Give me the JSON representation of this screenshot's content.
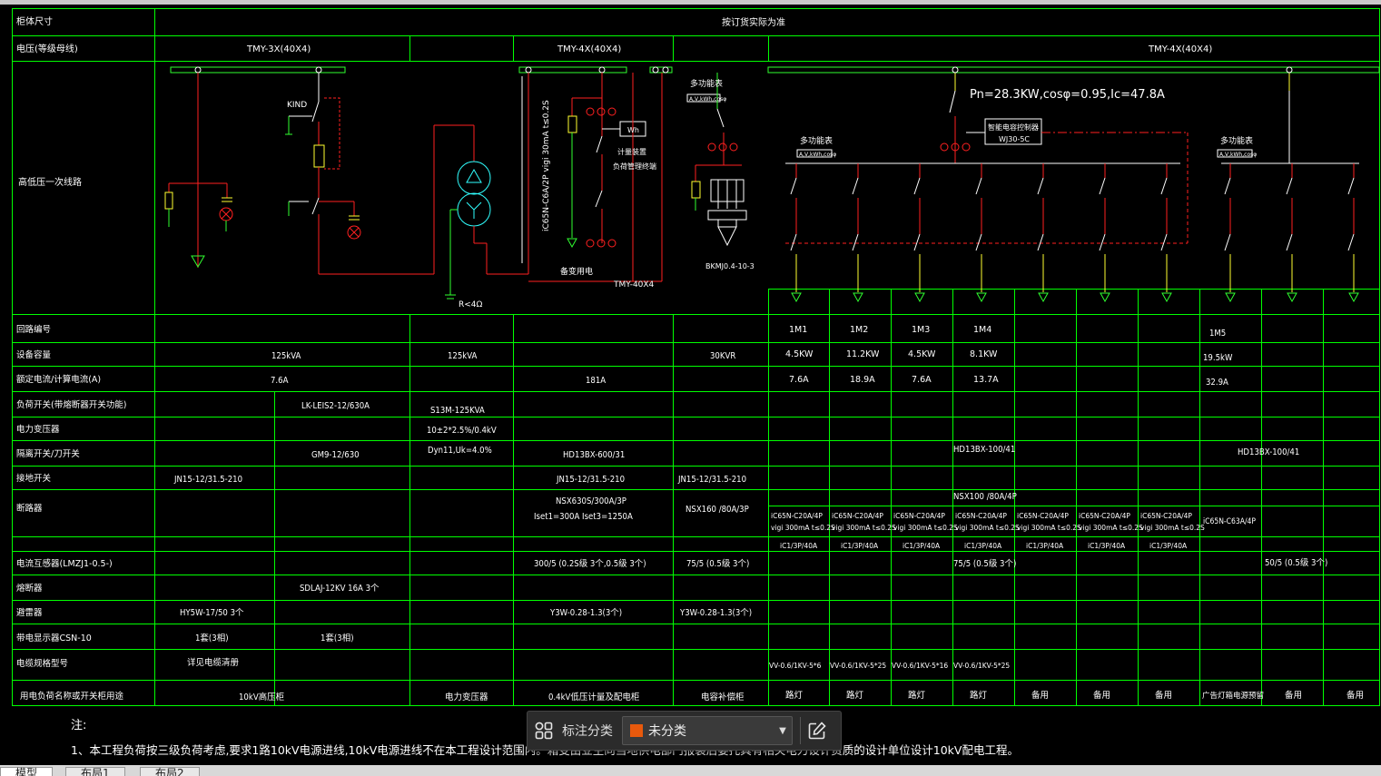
{
  "drawing": {
    "colors": {
      "grid": "#00ff00",
      "text": "#ffffff",
      "header_text": "#ffffff",
      "line_red": "#ff2020",
      "line_yellow": "#ffff30",
      "line_green": "#30ff30",
      "line_cyan": "#30ffff",
      "bg": "#000000"
    },
    "header": {
      "cabinet_size_label": "柜体尺寸",
      "cabinet_size_value": "按订货实际为准",
      "busbar_label": "电压(等级母线)",
      "bus1": "TMY-3X(40X4)",
      "bus2": "TMY-4X(40X4)",
      "bus3": "TMY-4X(40X4)",
      "diagram_label": "高低压一次线路"
    },
    "diagram_text": {
      "kind": "KIND",
      "ground": "R<4Ω",
      "breaker_label": "iC65N-C6A/2P vigi 30mA t≤0.2S",
      "meter_label": "计量装置 负荷管理终端",
      "wh": "Wh",
      "stand_by": "备变用电",
      "bus_small": "TMY-40X4",
      "multi_meter_1": "多功能表",
      "multi_meter_1_sub": "A,V,kWh,cosφ",
      "capacitor": "BKMJ0.4-10-3",
      "load_calc": "Pn=28.3KW,cosφ=0.95,Ic=47.8A",
      "controller_1": "智能电容控制器",
      "controller_2": "WJ30-5C",
      "multi_meter_2": "多功能表",
      "multi_meter_2_sub": "A,V,kWh,cosφ",
      "multi_meter_3": "多功能表",
      "multi_meter_3_sub": "A,V,kWh,cosφ"
    },
    "rows": {
      "circuit_no": "回路编号",
      "capacity": "设备容量",
      "current": "额定电流/计算电流(A)",
      "load_switch": "负荷开关(带熔断器开关功能)",
      "transformer": "电力变压器",
      "isolator": "隔离开关/刀开关",
      "earth_switch": "接地开关",
      "breaker": "断路器",
      "ct": "电流互感器(LMZJ1-0.5-)",
      "fuse": "熔断器",
      "arrester": "避雷器",
      "indicator": "带电显示器CSN-10",
      "cable": "电缆规格型号",
      "purpose": "用电负荷名称或开关柜用途"
    },
    "values": {
      "cap_hv": "125kVA",
      "cap_tr": "125kVA",
      "cap_cap": "30KVR",
      "cur_hv": "7.6A",
      "cur_lv": "181A",
      "ls_val": "LK-LEIS2-12/630A",
      "tr1": "S13M-125KVA",
      "tr2": "10±2*2.5%/0.4kV",
      "tr3": "Dyn11,Uk=4.0%",
      "iso_hv": "GM9-12/630",
      "iso_lv": "HD13BX-600/31",
      "iso_out": "HD13BX-100/41",
      "iso_out2": "HD13BX-100/41",
      "es1": "JN15-12/31.5-210",
      "es2": "JN15-12/31.5-210",
      "es3": "JN15-12/31.5-210",
      "br_main1": "NSX630S/300A/3P",
      "br_main2": "Iset1=300A    Iset3=1250A",
      "br_cap": "NSX160 /80A/3P",
      "br_out_hdr": "NSX100 /80A/4P",
      "br_last": "iC65N-C63A/4P",
      "ct_main": "300/5 (0.2S级 3个,0.5级 3个)",
      "ct_cap": "75/5 (0.5级 3个)",
      "ct_out": "75/5 (0.5级 3个)",
      "ct_last": "50/5 (0.5级 3个)",
      "fuse_val": "SDLAJ-12KV  16A  3个",
      "arr_hv": "HY5W-17/50   3个",
      "arr_lv": "Y3W-0.28-1.3(3个)",
      "arr_cap": "Y3W-0.28-1.3(3个)",
      "ind1": "1套(3相)",
      "ind2": "1套(3相)",
      "cable_hv": "详见电缆清册",
      "purp_hv": "10kV高压柜",
      "purp_tr": "电力变压器",
      "purp_lv": "0.4kV低压计量及配电柜",
      "purp_cap": "电容补偿柜",
      "purp_last": "广告灯箱电源预留"
    },
    "feeders": [
      {
        "no": "1M1",
        "kw": "4.5KW",
        "a": "7.6A",
        "br1": "iC65N-C20A/4P",
        "br2": "vigi 300mA  t≤0.2S",
        "aux": "iC1/3P/40A",
        "cable": "VV-0.6/1KV-5*6",
        "purpose": "路灯"
      },
      {
        "no": "1M2",
        "kw": "11.2KW",
        "a": "18.9A",
        "br1": "iC65N-C20A/4P",
        "br2": "vigi 300mA  t≤0.2S",
        "aux": "iC1/3P/40A",
        "cable": "VV-0.6/1KV-5*25",
        "purpose": "路灯"
      },
      {
        "no": "1M3",
        "kw": "4.5KW",
        "a": "7.6A",
        "br1": "iC65N-C20A/4P",
        "br2": "vigi 300mA  t≤0.2S",
        "aux": "iC1/3P/40A",
        "cable": "VV-0.6/1KV-5*16",
        "purpose": "路灯"
      },
      {
        "no": "1M4",
        "kw": "8.1KW",
        "a": "13.7A",
        "br1": "iC65N-C20A/4P",
        "br2": "vigi 300mA  t≤0.2S",
        "aux": "iC1/3P/40A",
        "cable": "VV-0.6/1KV-5*25",
        "purpose": "路灯"
      },
      {
        "no": "",
        "kw": "",
        "a": "",
        "br1": "iC65N-C20A/4P",
        "br2": "vigi 300mA  t≤0.2S",
        "aux": "iC1/3P/40A",
        "cable": "",
        "purpose": "备用"
      },
      {
        "no": "",
        "kw": "",
        "a": "",
        "br1": "iC65N-C20A/4P",
        "br2": "vigi 300mA  t≤0.2S",
        "aux": "iC1/3P/40A",
        "cable": "",
        "purpose": "备用"
      },
      {
        "no": "",
        "kw": "",
        "a": "",
        "br1": "iC65N-C20A/4P",
        "br2": "vigi 300mA  t≤0.2S",
        "aux": "iC1/3P/40A",
        "cable": "",
        "purpose": "备用"
      }
    ],
    "last_feeder": {
      "no": "1M5",
      "kw": "19.5kW",
      "a": "32.9A"
    },
    "tail_purposes": [
      "备用",
      "备用"
    ],
    "notes_title": "注:",
    "notes_line1": "1、本工程负荷按三级负荷考虑,要求1路10kV电源进线,10kV电源进线不在本工程设计范围内。箱变由业主向当地供电部门报装后委托具有相关电力设计资质的设计单位设计10kV配电工程。"
  },
  "toolbar": {
    "grid_icon": "grid-icon",
    "label": "标注分类",
    "select_value": "未分类",
    "select_color": "#e8590c",
    "edit_icon": "edit-icon"
  },
  "layout_tabs": [
    "模型",
    "布局1",
    "布局2"
  ]
}
